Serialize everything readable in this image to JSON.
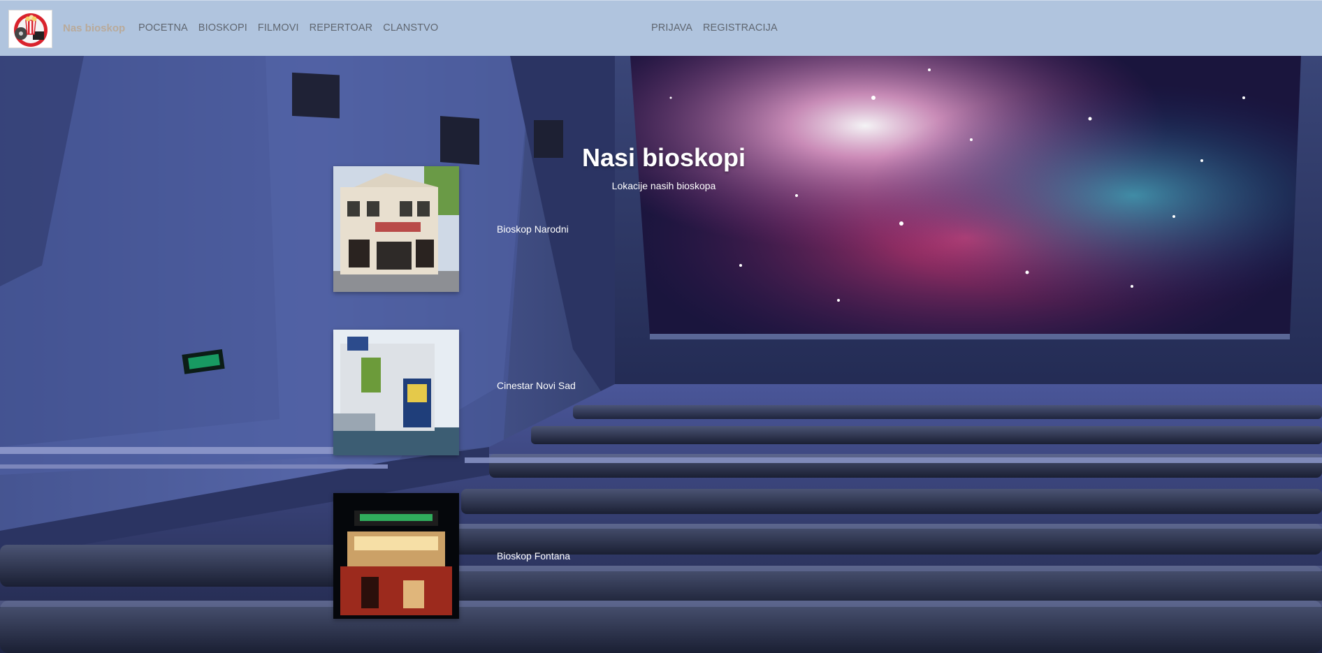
{
  "nav": {
    "brand": "Nas bioskop",
    "links_left": [
      "POCETNA",
      "BIOSKOPI",
      "FILMOVI",
      "REPERTOAR",
      "CLANSTVO"
    ],
    "links_right": [
      "PRIJAVA",
      "REGISTRACIJA"
    ]
  },
  "main": {
    "title": "Nasi bioskopi",
    "subtitle": "Lokacije nasih bioskopa",
    "cinemas": [
      {
        "name": "Bioskop Narodni"
      },
      {
        "name": "Cinestar Novi Sad"
      },
      {
        "name": "Bioskop Fontana"
      }
    ]
  },
  "colors": {
    "navbar_bg": "#b0c4de",
    "nav_link": "#5f6670",
    "brand": "#b9aa9a",
    "text_on_hero": "#ffffff"
  },
  "icons": {
    "logo": "film-reel-popcorn-logo"
  }
}
